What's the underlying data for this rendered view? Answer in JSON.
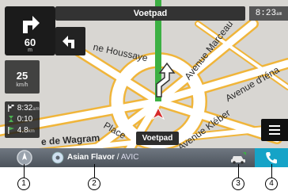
{
  "header": {
    "street_name": "Voetpad",
    "clock_time": "8:23",
    "clock_suffix": "am"
  },
  "turn_panel": {
    "distance": "60",
    "distance_unit": "m",
    "main_maneuver_icon": "turn-right-arrow-icon",
    "next_maneuver_icon": "turn-left-arrow-icon"
  },
  "speed": {
    "value": "25",
    "unit": "km/h"
  },
  "trip": {
    "arrival_time": "8:32",
    "arrival_suffix": "am",
    "remaining_time": "0:10",
    "remaining_distance": "4.8",
    "remaining_distance_unit": "km"
  },
  "map": {
    "labels": {
      "houssaye": "ne Houssaye",
      "marceau": "Avenue Marceau",
      "iena": "Avenue d'Iéna",
      "kleber": "Avenue Kléber",
      "place": "Place",
      "wagram": "e de Wagram"
    },
    "current_street": "Voetpad",
    "route_color": "#3cb043",
    "road_color": "#ffffff",
    "road_edge_color": "#f0b53a"
  },
  "bottom_bar": {
    "track_title": "Asian Flavor",
    "separator": " / ",
    "source": "AVIC",
    "phone_color": "#16a3c7"
  },
  "callouts": [
    "1",
    "2",
    "3",
    "4"
  ]
}
